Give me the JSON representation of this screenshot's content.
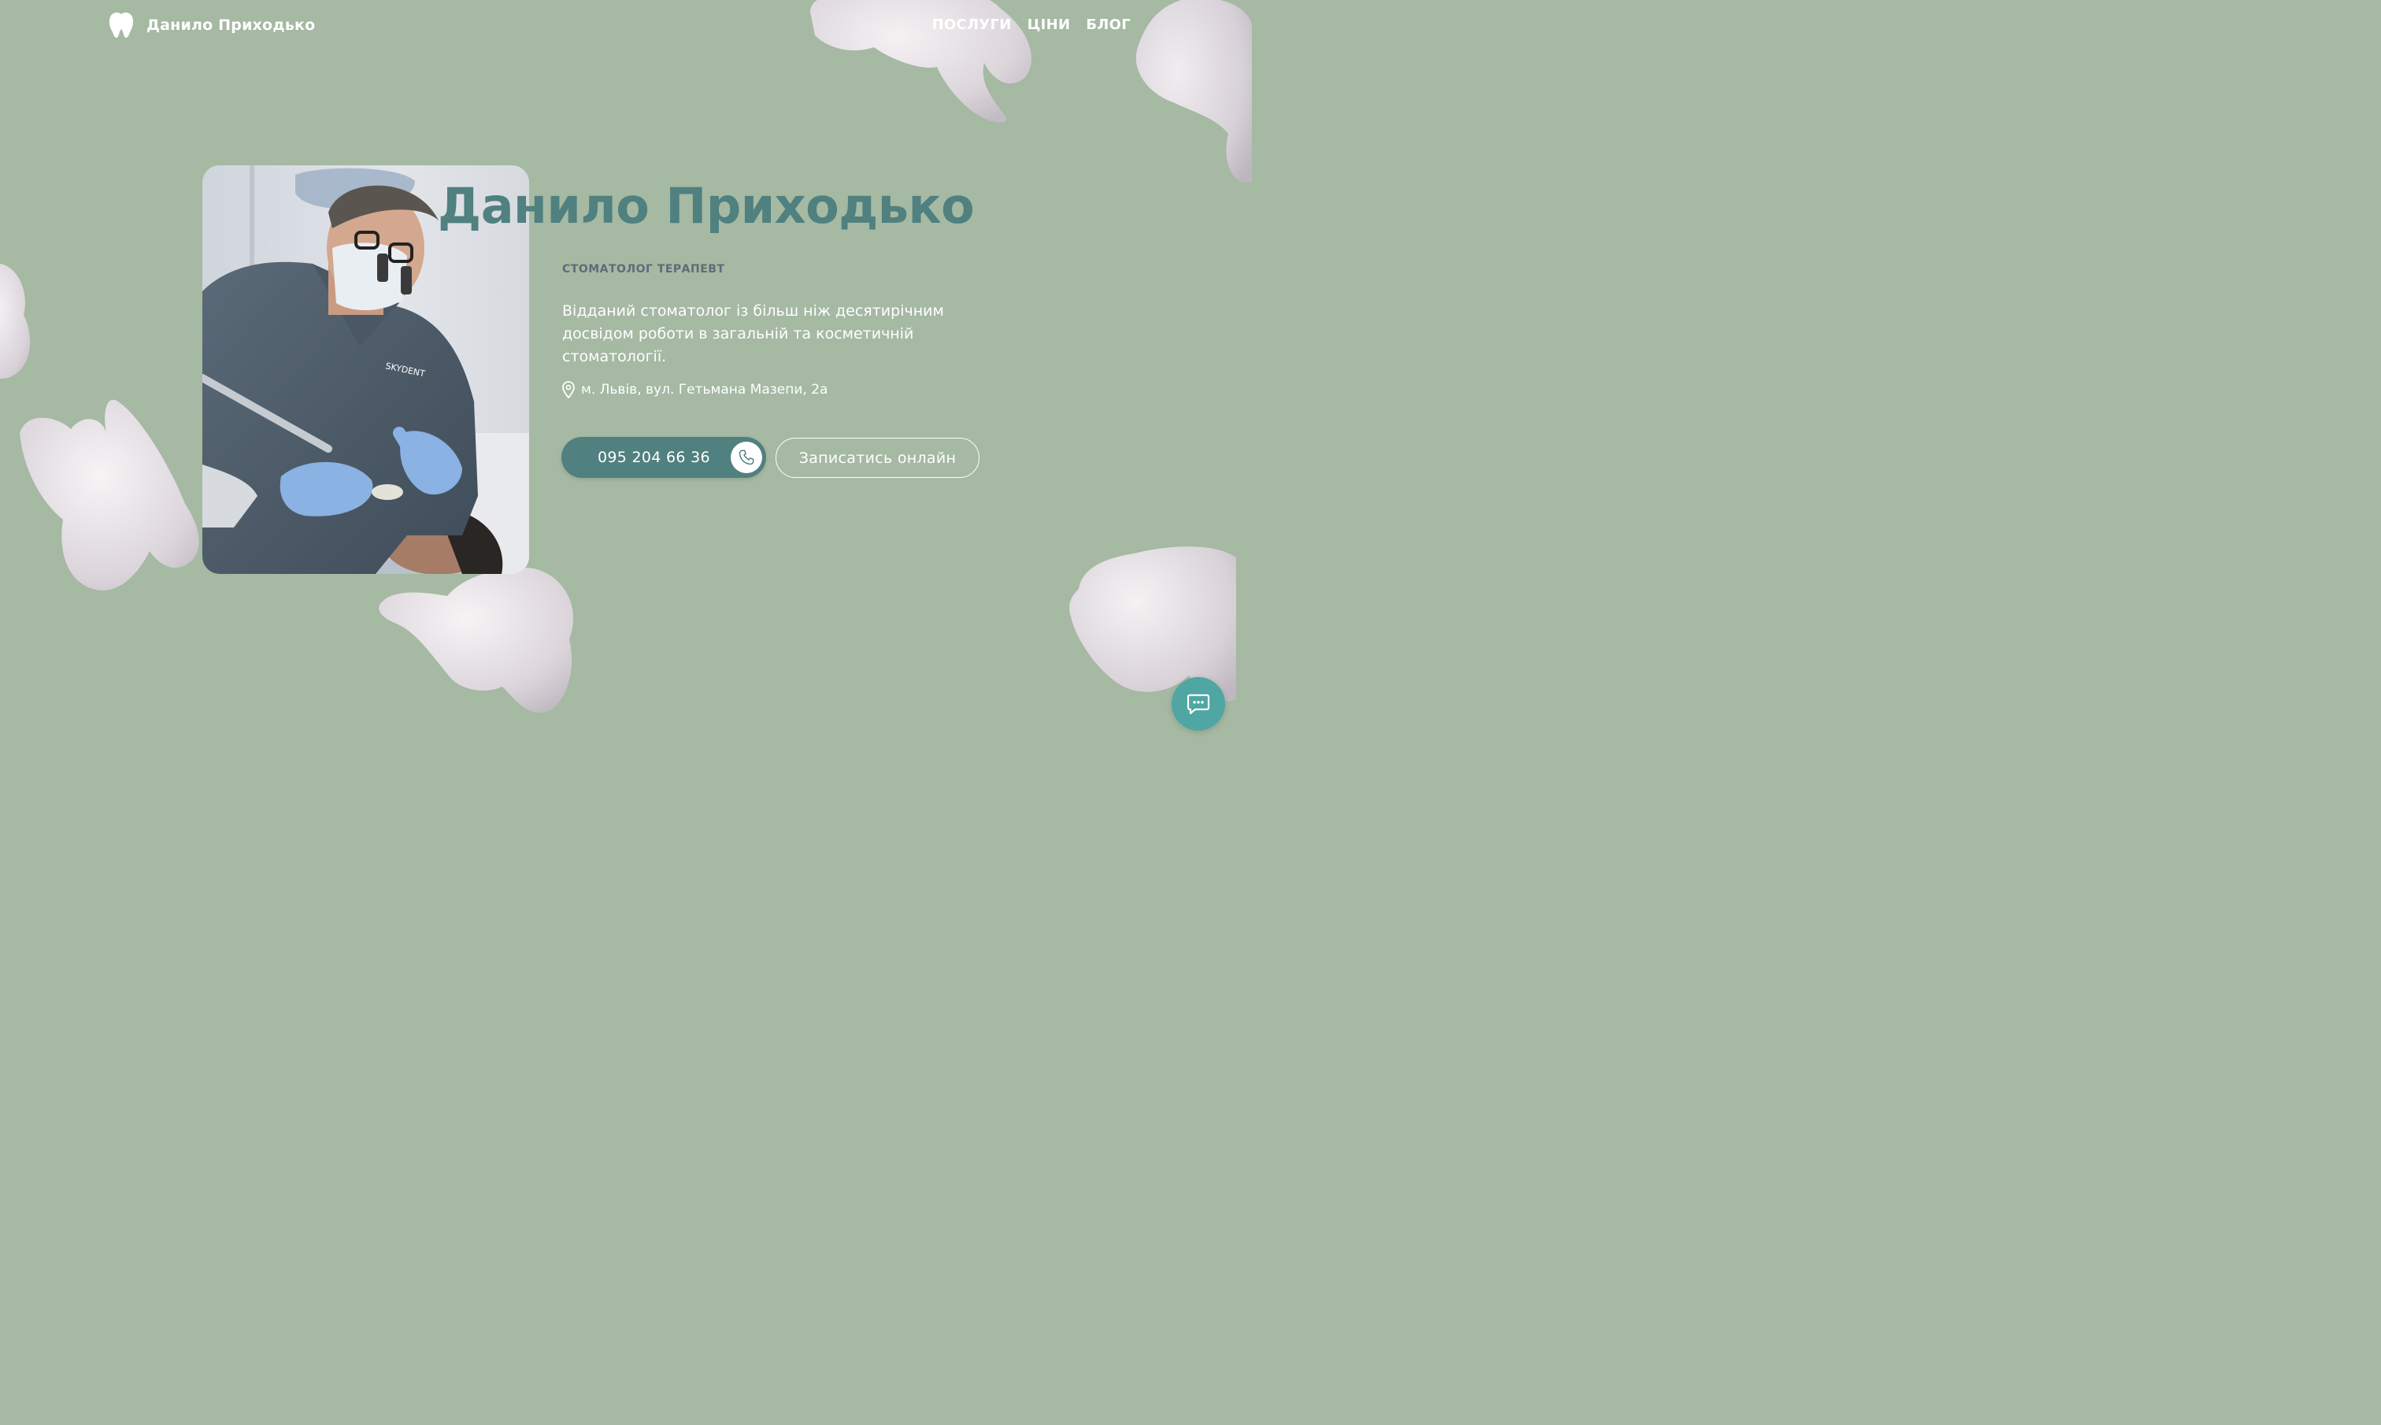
{
  "header": {
    "logo_text": "Данило Приходько",
    "logo_icon": "tooth-icon"
  },
  "nav": {
    "items": [
      {
        "label": "ПОСЛУГИ"
      },
      {
        "label": "ЦІНИ"
      },
      {
        "label": "БЛОГ"
      }
    ]
  },
  "hero": {
    "title": "Данило Приходько",
    "subtitle": "СТОМАТОЛОГ ТЕРАПЕВТ",
    "description": "Відданий стоматолог із більш ніж десятирічним досвідом роботи в загальній та косметичній стоматології.",
    "address": "м. Львів, вул. Гетьмана Мазепи, 2а",
    "address_icon": "location-pin-icon",
    "photo_logo_text": "SKYDENT"
  },
  "buttons": {
    "phone_label": "095 204 66 36",
    "phone_icon": "phone-icon",
    "online_label": "Записатись онлайн"
  },
  "chat": {
    "icon": "chat-icon"
  },
  "colors": {
    "background": "#a5b9a3",
    "accent": "#50807f",
    "chat": "#4fa6a3",
    "subtitle": "#5f6b78"
  }
}
